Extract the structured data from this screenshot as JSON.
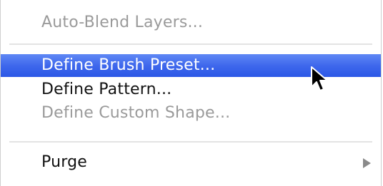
{
  "menu": {
    "items": [
      {
        "label": "Auto-Blend Layers...",
        "state": "disabled"
      },
      {
        "label": "Define Brush Preset...",
        "state": "highlighted"
      },
      {
        "label": "Define Pattern...",
        "state": "enabled"
      },
      {
        "label": "Define Custom Shape...",
        "state": "disabled"
      },
      {
        "label": "Purge",
        "state": "enabled",
        "submenu_icon": "submenu-arrow-icon"
      }
    ]
  },
  "colors": {
    "highlight": "#3f68ec",
    "disabled_text": "#9a9a9a",
    "enabled_text": "#111111"
  },
  "cursor_icon": "mouse-pointer-icon"
}
